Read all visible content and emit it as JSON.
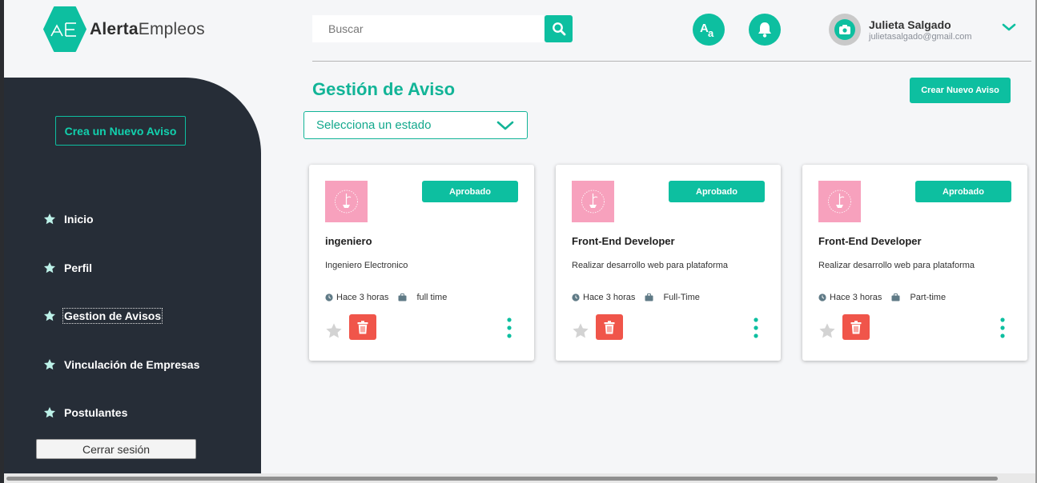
{
  "header": {
    "brand_bold": "Alerta",
    "brand_light": "Empleos",
    "logo_icon": "alertaempleos-hexagon-logo",
    "search_placeholder": "Buscar",
    "search_icon": "search-icon",
    "font_icon": "font-size-icon",
    "bell_icon": "bell-icon",
    "user": {
      "name": "Julieta Salgado",
      "email": "julietasalgado@gmail.com",
      "avatar_icon": "camera-icon"
    },
    "menu_icon": "chevron-down-icon"
  },
  "sidebar": {
    "cta_label": "Crea un Nuevo Aviso",
    "items": [
      {
        "label": "Inicio",
        "icon": "star-icon"
      },
      {
        "label": "Perfil",
        "icon": "star-icon"
      },
      {
        "label": "Gestion de Avisos",
        "icon": "star-icon",
        "active": true
      },
      {
        "label": "Vinculación de Empresas",
        "icon": "star-icon"
      },
      {
        "label": "Postulantes",
        "icon": "star-icon"
      }
    ],
    "logout_label": "Cerrar sesión"
  },
  "main": {
    "title": "Gestión de Aviso",
    "create_label": "Crear Nuevo Aviso",
    "status_placeholder": "Selecciona un estado",
    "cards": [
      {
        "status": "Aprobado",
        "title": "ingeniero",
        "description": "Ingeniero Electronico",
        "time": "Hace 3 horas",
        "type": "full time"
      },
      {
        "status": "Aprobado",
        "title": "Front-End Developer",
        "description": "Realizar desarrollo web para plataforma",
        "time": "Hace 3 horas",
        "type": "Full-Time"
      },
      {
        "status": "Aprobado",
        "title": "Front-End Developer",
        "description": "Realizar desarrollo web para plataforma",
        "time": "Hace 3 horas",
        "type": "Part-time"
      }
    ]
  },
  "colors": {
    "accent": "#0dbfa0",
    "sidebar_bg": "#262d37",
    "delete": "#f0554a",
    "company_logo": "#f7a1bd"
  }
}
